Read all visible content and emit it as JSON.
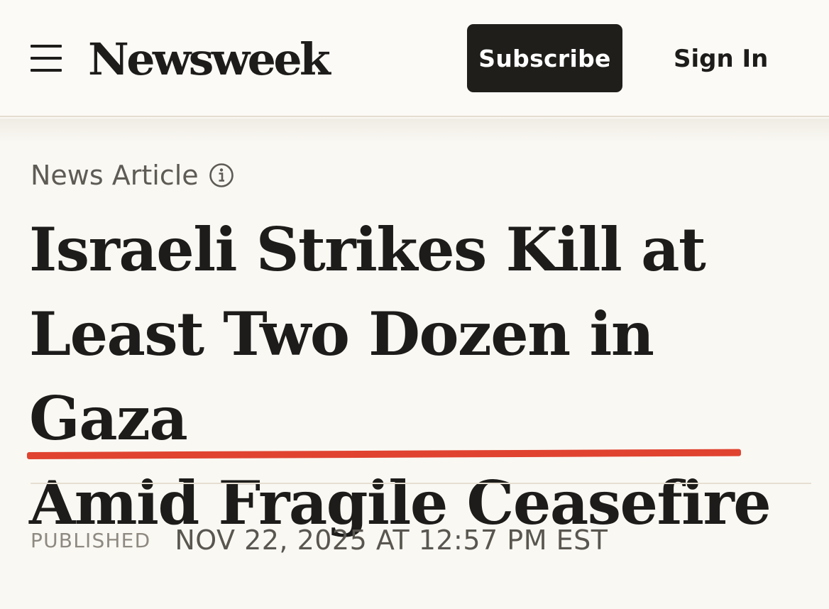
{
  "header": {
    "brand": "Newsweek",
    "subscribe_label": "Subscribe",
    "signin_label": "Sign In",
    "menu_icon": "hamburger-menu-icon"
  },
  "article": {
    "type_label": "News Article",
    "info_icon": "info-circle-icon",
    "headline_lines": [
      "Israeli Strikes Kill at",
      "Least Two Dozen in Gaza",
      "Amid Fragile Ceasefire"
    ],
    "published_label": "PUBLISHED",
    "published_date": "NOV 22, 2025 AT 12:57 PM EST"
  },
  "colors": {
    "background": "#faf8f3",
    "text": "#1d1c1a",
    "subscribe_bg": "#1f1e1b",
    "accent_underline": "#e04330",
    "muted": "#8e8a82"
  }
}
